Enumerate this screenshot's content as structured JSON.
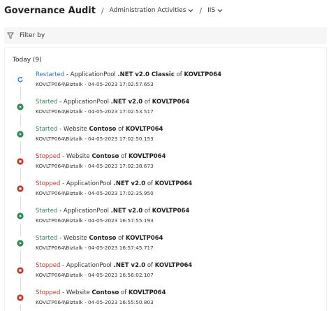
{
  "header": {
    "title": "Governance Audit",
    "separator": "/",
    "breadcrumbs": [
      {
        "label": "Administration Activities"
      },
      {
        "label": "IIS"
      }
    ]
  },
  "filter": {
    "label": "Filter by"
  },
  "group": {
    "title": "Today (9)"
  },
  "colors": {
    "restarted": "#2f6fd6",
    "started": "#2e8b57",
    "stopped": "#c0392b"
  },
  "entries": [
    {
      "action": "Restarted",
      "status": "restarted",
      "icon": "restart-icon",
      "type": "ApplicationPool",
      "name": ".NET v2.0 Classic",
      "of": "of",
      "server": "KOVLTP064",
      "user": "KOVLTP064\\Biztalk",
      "timestamp": "04-05-2023 17:02:57.653"
    },
    {
      "action": "Started",
      "status": "started",
      "icon": "play-icon",
      "type": "ApplicationPool",
      "name": ".NET v2.0",
      "of": "of",
      "server": "KOVLTP064",
      "user": "KOVLTP064\\Biztalk",
      "timestamp": "04-05-2023 17:02:53.517"
    },
    {
      "action": "Started",
      "status": "started",
      "icon": "play-icon",
      "type": "Website",
      "name": "Contoso",
      "of": "of",
      "server": "KOVLTP064",
      "user": "KOVLTP064\\Biztalk",
      "timestamp": "04-05-2023 17:02:50.153"
    },
    {
      "action": "Stopped",
      "status": "stopped",
      "icon": "stop-icon",
      "type": "Website",
      "name": "Contoso",
      "of": "of",
      "server": "KOVLTP064",
      "user": "KOVLTP064\\Biztalk",
      "timestamp": "04-05-2023 17:02:38.673"
    },
    {
      "action": "Stopped",
      "status": "stopped",
      "icon": "stop-icon",
      "type": "ApplicationPool",
      "name": ".NET v2.0",
      "of": "of",
      "server": "KOVLTP064",
      "user": "KOVLTP064\\Biztalk",
      "timestamp": "04-05-2023 17:02:35.950"
    },
    {
      "action": "Started",
      "status": "started",
      "icon": "play-icon",
      "type": "ApplicationPool",
      "name": ".NET v2.0",
      "of": "of",
      "server": "KOVLTP064",
      "user": "KOVLTP064\\Biztalk",
      "timestamp": "04-05-2023 16:57:55.193"
    },
    {
      "action": "Started",
      "status": "started",
      "icon": "play-icon",
      "type": "Website",
      "name": "Contoso",
      "of": "of",
      "server": "KOVLTP064",
      "user": "KOVLTP064\\Biztalk",
      "timestamp": "04-05-2023 16:57:45.717"
    },
    {
      "action": "Stopped",
      "status": "stopped",
      "icon": "stop-icon",
      "type": "ApplicationPool",
      "name": ".NET v2.0",
      "of": "of",
      "server": "KOVLTP064",
      "user": "KOVLTP064\\Biztalk",
      "timestamp": "04-05-2023 16:56:02.107"
    },
    {
      "action": "Stopped",
      "status": "stopped",
      "icon": "stop-icon",
      "type": "Website",
      "name": "Contoso",
      "of": "of",
      "server": "KOVLTP064",
      "user": "KOVLTP064\\Biztalk",
      "timestamp": "04-05-2023 16:55:50.803"
    }
  ]
}
